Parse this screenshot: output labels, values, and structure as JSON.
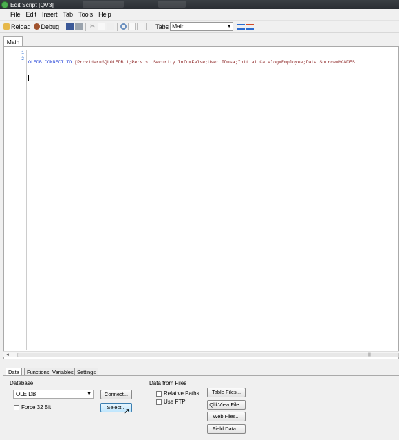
{
  "window": {
    "title": "Edit Script [QV3]"
  },
  "menu": [
    "File",
    "Edit",
    "Insert",
    "Tab",
    "Tools",
    "Help"
  ],
  "toolbar": {
    "reload": "Reload",
    "debug": "Debug",
    "tabs_label": "Tabs",
    "tabs_value": "Main"
  },
  "editor": {
    "tab": "Main",
    "line_numbers": [
      "1",
      "2"
    ],
    "line1_kw": "OLEDB CONNECT TO ",
    "line1_str": "[Provider=SQLOLEDB.1;Persist Security Info=False;User ID=sa;Initial Catalog=Employee;Data Source=MCNDES"
  },
  "bottom_tabs": [
    "Data",
    "Functions",
    "Variables",
    "Settings"
  ],
  "database": {
    "label": "Database",
    "selected": "OLE DB",
    "connect": "Connect...",
    "select": "Select...",
    "force32": "Force 32 Bit"
  },
  "files": {
    "label": "Data from Files",
    "relative_paths": "Relative Paths",
    "use_ftp": "Use FTP",
    "table_files": "Table Files...",
    "qlikview_file": "QlikView File...",
    "web_files": "Web Files...",
    "field_data": "Field Data..."
  }
}
